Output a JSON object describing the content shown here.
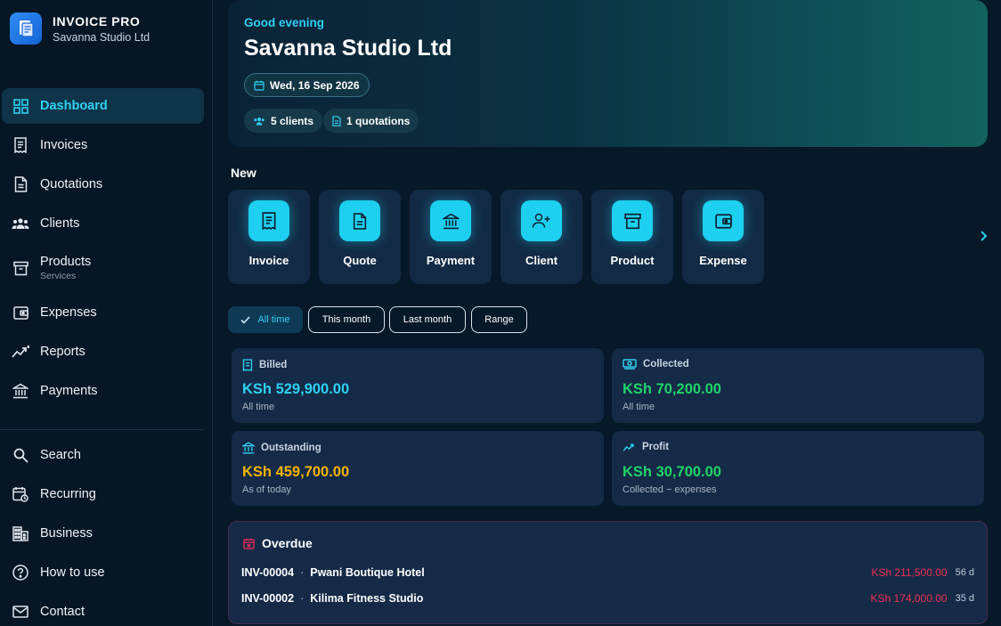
{
  "app": {
    "title": "INVOICE PRO",
    "business": "Savanna Studio Ltd"
  },
  "sidebar": {
    "items": [
      {
        "label": "Dashboard",
        "icon": "dashboard-grid-icon",
        "active": true
      },
      {
        "label": "Invoices",
        "icon": "invoice-icon"
      },
      {
        "label": "Quotations",
        "icon": "document-icon"
      },
      {
        "label": "Clients",
        "icon": "people-icon"
      },
      {
        "label": "Products",
        "sub": "Services",
        "icon": "archive-box-icon"
      },
      {
        "label": "Expenses",
        "icon": "wallet-icon"
      },
      {
        "label": "Reports",
        "icon": "trending-icon"
      },
      {
        "label": "Payments",
        "icon": "bank-icon"
      }
    ],
    "bottom_items": [
      {
        "label": "Search",
        "icon": "search-icon"
      },
      {
        "label": "Recurring",
        "icon": "calendar-repeat-icon"
      },
      {
        "label": "Business",
        "icon": "building-icon"
      },
      {
        "label": "How to use",
        "icon": "help-circle-icon"
      },
      {
        "label": "Contact",
        "icon": "mail-icon"
      }
    ]
  },
  "hero": {
    "greeting": "Good evening",
    "name": "Savanna Studio Ltd",
    "date": "Wed, 16 Sep 2026",
    "clients": "5 clients",
    "quotations": "1 quotations"
  },
  "quick_actions": {
    "heading": "New",
    "items": [
      {
        "label": "Invoice",
        "icon": "invoice-icon"
      },
      {
        "label": "Quote",
        "icon": "document-icon"
      },
      {
        "label": "Payment",
        "icon": "bank-icon"
      },
      {
        "label": "Client",
        "icon": "add-person-icon"
      },
      {
        "label": "Product",
        "icon": "archive-box-icon"
      },
      {
        "label": "Expense",
        "icon": "wallet-icon"
      }
    ],
    "more_icon": "chevron-right-icon"
  },
  "filters": {
    "items": [
      "All time",
      "This month",
      "Last month",
      "Range"
    ],
    "selected": "All time"
  },
  "stats": {
    "billed": {
      "label": "Billed",
      "value": "KSh 529,900.00",
      "note": "All time",
      "color": "#2fd0f2"
    },
    "collected": {
      "label": "Collected",
      "value": "KSh 70,200.00",
      "note": "All time",
      "color": "#21d36a"
    },
    "outstanding": {
      "label": "Outstanding",
      "value": "KSh 459,700.00",
      "note": "As of today",
      "color": "#f5b400"
    },
    "profit": {
      "label": "Profit",
      "value": "KSh 30,700.00",
      "note": "Collected − expenses",
      "color": "#21d36a"
    }
  },
  "overdue": {
    "title": "Overdue",
    "rows": [
      {
        "invoice": "INV-00004",
        "client": "Pwani Boutique Hotel",
        "amount": "KSh 211,500.00",
        "days": "56 d"
      },
      {
        "invoice": "INV-00002",
        "client": "Kilima Fitness Studio",
        "amount": "KSh 174,000.00",
        "days": "35 d"
      }
    ]
  },
  "colors": {
    "accent": "#2fd0f2",
    "background": "#071828",
    "card": "#142a47",
    "overdue_red": "#ef2f54"
  }
}
